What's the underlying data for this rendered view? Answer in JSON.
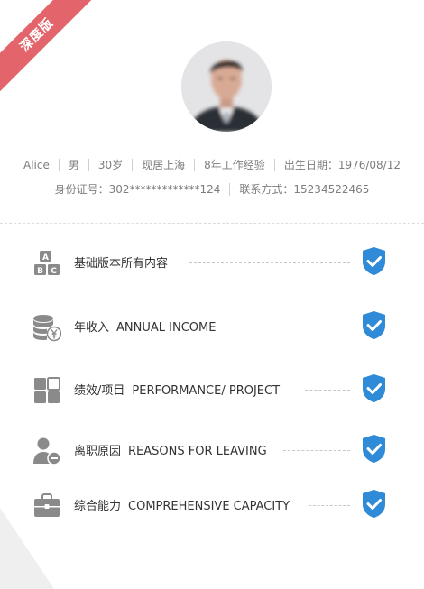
{
  "badge": {
    "label": "深度版",
    "color": "#e3646b"
  },
  "profile": {
    "name": "Alice",
    "gender": "男",
    "age": "30岁",
    "residence": "现居上海",
    "experience": "8年工作经验",
    "birth": "出生日期：1976/08/12",
    "id_number": "身份证号：302*************124",
    "contact": "联系方式：15234522465"
  },
  "features": [
    {
      "zh": "基础版本所有内容",
      "en": "",
      "icon": "abc-blocks-icon",
      "check": "shield-check-icon"
    },
    {
      "zh": "年收入",
      "en": "ANNUAL INCOME",
      "icon": "coins-yen-icon",
      "check": "shield-check-icon"
    },
    {
      "zh": "绩效/项目",
      "en": "PERFORMANCE/ PROJECT",
      "icon": "grid-tiles-icon",
      "check": "shield-check-icon"
    },
    {
      "zh": "离职原因",
      "en": "REASONS FOR LEAVING",
      "icon": "user-minus-icon",
      "check": "shield-check-icon"
    },
    {
      "zh": "综合能力",
      "en": "COMPREHENSIVE CAPACITY",
      "icon": "briefcase-icon",
      "check": "shield-check-icon"
    }
  ],
  "colors": {
    "accent": "#2f8ad8",
    "icon_gray": "#8a8a8a",
    "text": "#333333",
    "muted": "#7d7d7d"
  }
}
